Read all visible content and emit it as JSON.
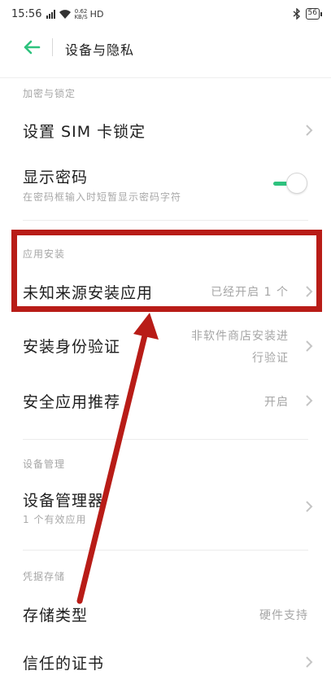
{
  "status_bar": {
    "time": "15:56",
    "net_speed_value": "0.62",
    "net_speed_unit": "KB/S",
    "network": "HD",
    "battery": "56"
  },
  "header": {
    "title": "设备与隐私"
  },
  "sections": {
    "encryption": {
      "label": "加密与锁定"
    },
    "install": {
      "label": "应用安装"
    },
    "device_mgmt": {
      "label": "设备管理"
    },
    "credentials": {
      "label": "凭据存储"
    }
  },
  "rows": {
    "sim_lock": {
      "title": "设置 SIM 卡锁定"
    },
    "show_password": {
      "title": "显示密码",
      "subtitle": "在密码框输入时短暂显示密码字符",
      "enabled": true
    },
    "unknown_sources": {
      "title": "未知来源安装应用",
      "value": "已经开启 1 个"
    },
    "install_auth": {
      "title": "安装身份验证",
      "value_line1": "非软件商店安装进",
      "value_line2": "行验证"
    },
    "safe_app_recommend": {
      "title": "安全应用推荐",
      "value": "开启"
    },
    "device_admin": {
      "title": "设备管理器",
      "subtitle": "1 个有效应用"
    },
    "storage_type": {
      "title": "存储类型",
      "value": "硬件支持"
    },
    "trusted_certs": {
      "title": "信任的证书"
    }
  },
  "colors": {
    "accent": "#2ec27e",
    "annotation": "#b81c17"
  }
}
